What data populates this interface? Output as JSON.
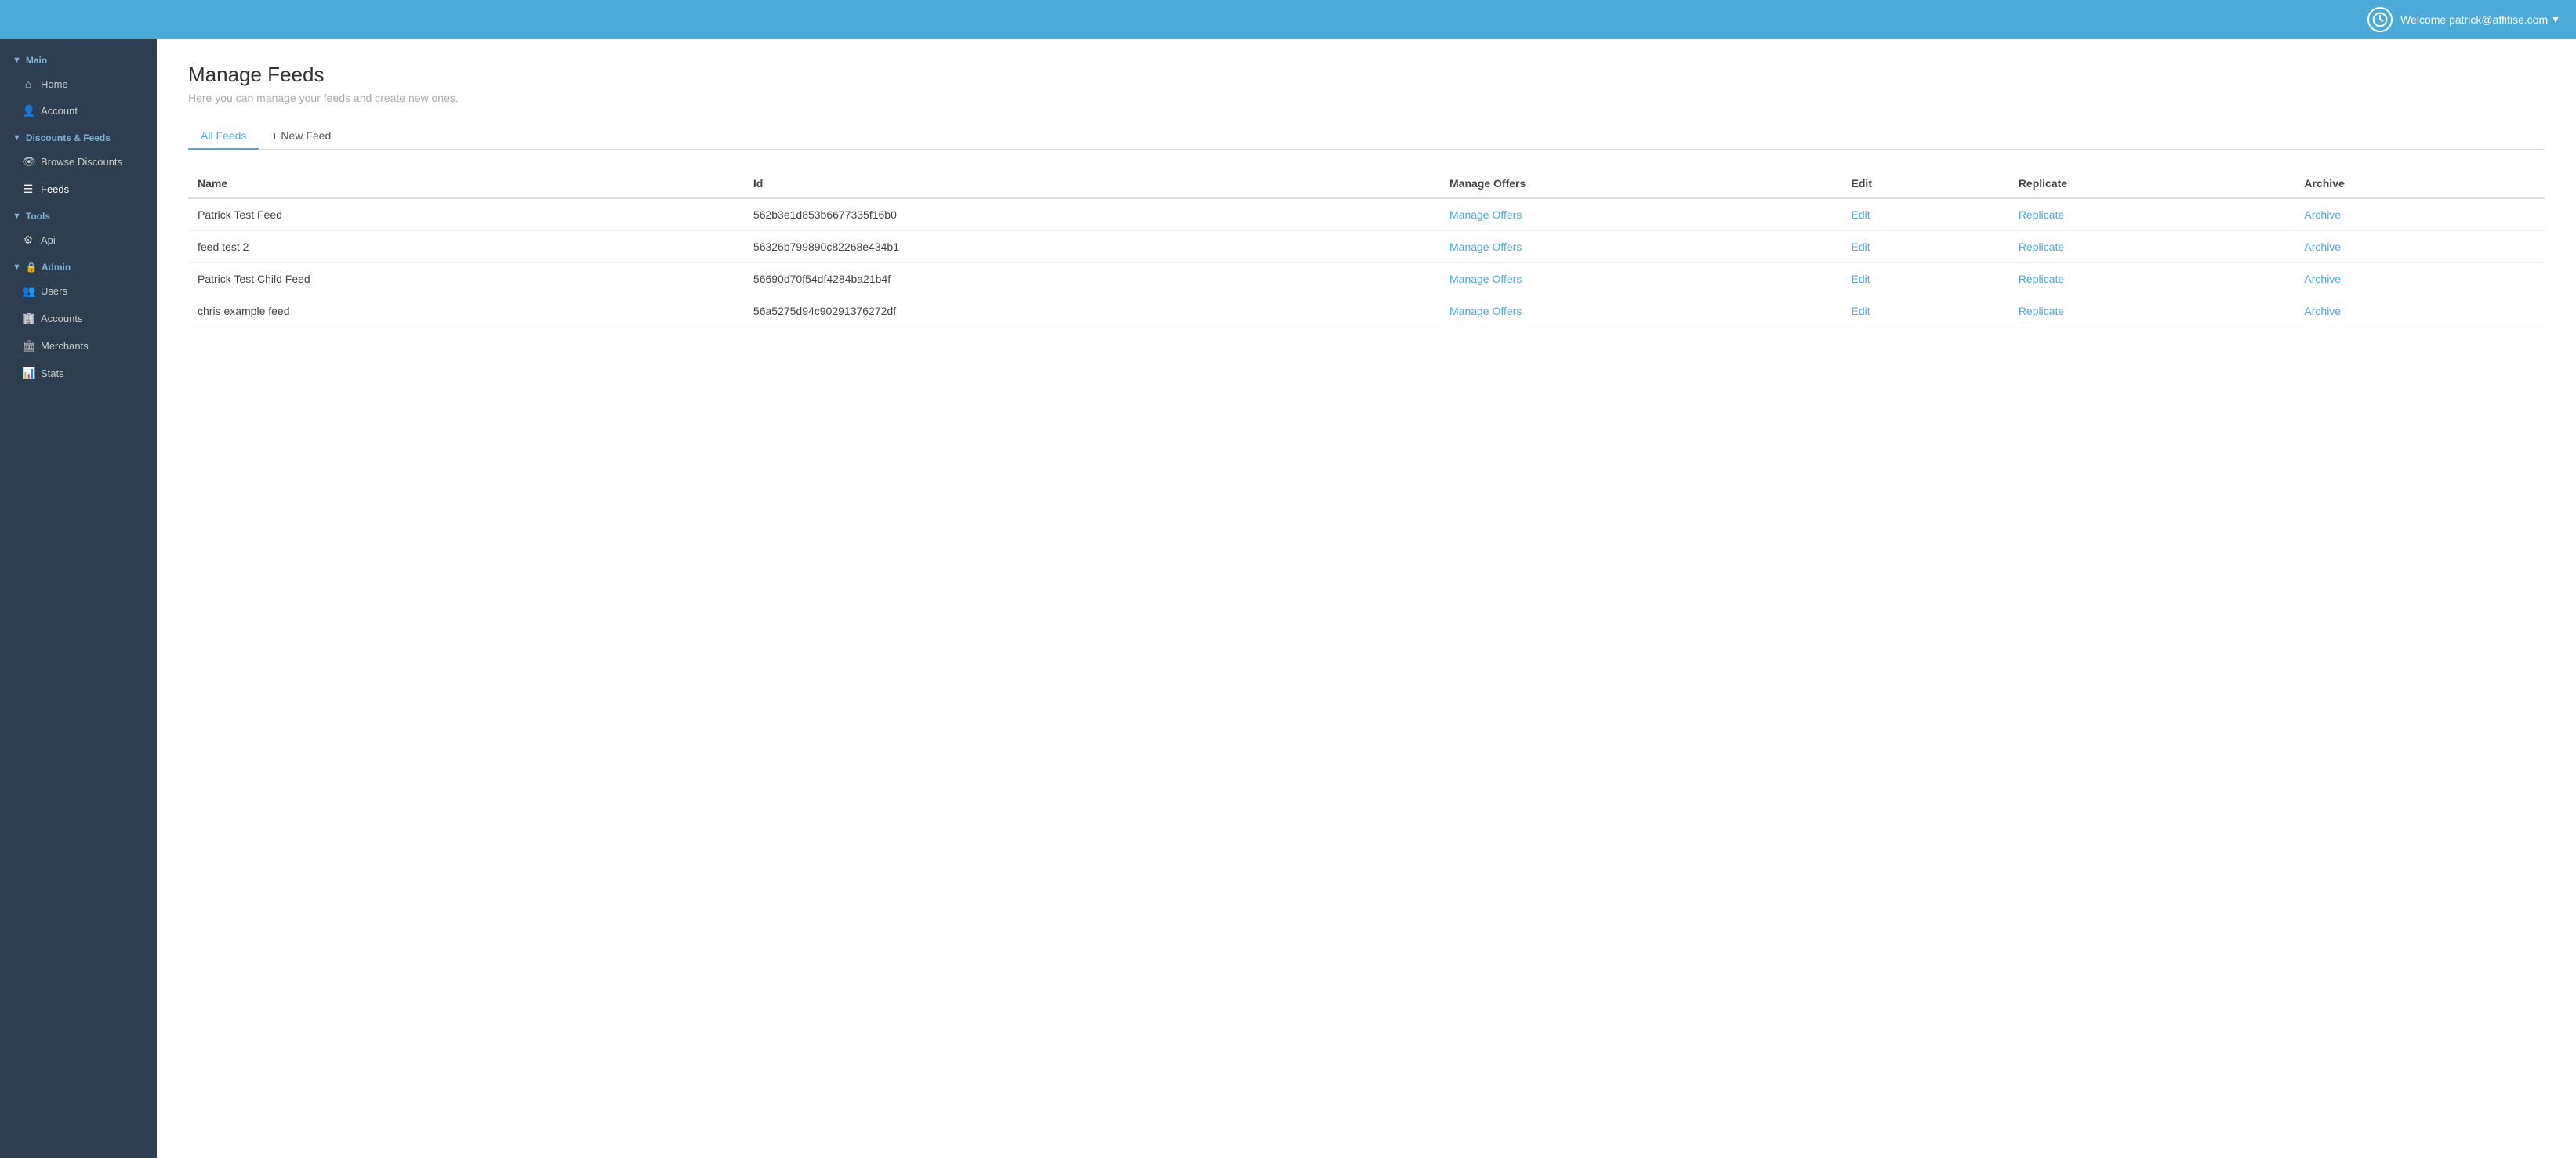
{
  "topbar": {
    "welcome_text": "Welcome patrick@affitise.com",
    "dropdown_arrow": "▼",
    "logo_label": "Affitise logo"
  },
  "sidebar": {
    "sections": [
      {
        "label": "Main",
        "key": "main",
        "items": [
          {
            "label": "Home",
            "icon": "⌂",
            "name": "home"
          },
          {
            "label": "Account",
            "icon": "👤",
            "name": "account"
          }
        ]
      },
      {
        "label": "Discounts & Feeds",
        "key": "discounts-feeds",
        "items": [
          {
            "label": "Browse Discounts",
            "icon": "👁",
            "name": "browse-discounts"
          },
          {
            "label": "Feeds",
            "icon": "☰",
            "name": "feeds",
            "active": true
          }
        ]
      },
      {
        "label": "Tools",
        "key": "tools",
        "items": [
          {
            "label": "Api",
            "icon": "⚙",
            "name": "api"
          }
        ]
      },
      {
        "label": "Admin",
        "key": "admin",
        "items": [
          {
            "label": "Users",
            "icon": "👥",
            "name": "users"
          },
          {
            "label": "Accounts",
            "icon": "🏢",
            "name": "accounts"
          },
          {
            "label": "Merchants",
            "icon": "🏛",
            "name": "merchants"
          },
          {
            "label": "Stats",
            "icon": "📊",
            "name": "stats"
          }
        ]
      }
    ]
  },
  "main": {
    "page_title": "Manage Feeds",
    "page_subtitle": "Here you can manage your feeds and create new ones.",
    "tabs": [
      {
        "label": "All Feeds",
        "active": true
      },
      {
        "label": "+ New Feed",
        "active": false
      }
    ],
    "table": {
      "columns": [
        "Name",
        "Id",
        "Manage Offers",
        "Edit",
        "Replicate",
        "Archive"
      ],
      "rows": [
        {
          "name": "Patrick Test Feed",
          "id": "562b3e1d853b6677335f16b0",
          "manage_offers": "Manage Offers",
          "edit": "Edit",
          "replicate": "Replicate",
          "archive": "Archive"
        },
        {
          "name": "feed test 2",
          "id": "56326b799890c82268e434b1",
          "manage_offers": "Manage Offers",
          "edit": "Edit",
          "replicate": "Replicate",
          "archive": "Archive"
        },
        {
          "name": "Patrick Test Child Feed",
          "id": "56690d70f54df4284ba21b4f",
          "manage_offers": "Manage Offers",
          "edit": "Edit",
          "replicate": "Replicate",
          "archive": "Archive"
        },
        {
          "name": "chris example feed",
          "id": "56a5275d94c90291376272df",
          "manage_offers": "Manage Offers",
          "edit": "Edit",
          "replicate": "Replicate",
          "archive": "Archive"
        }
      ]
    }
  }
}
